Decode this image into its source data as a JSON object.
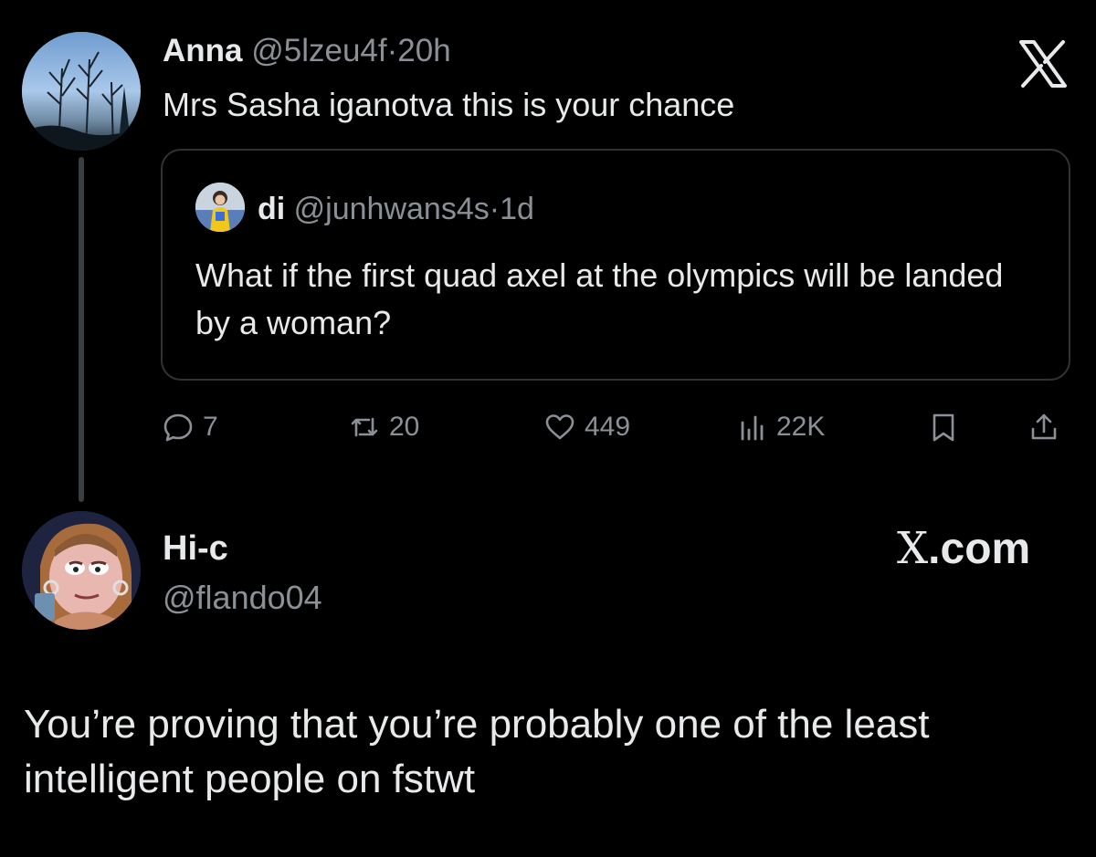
{
  "tweet": {
    "author_name": "Anna",
    "author_handle": "@5lzeu4f",
    "separator": "·",
    "time": "20h",
    "text": "Mrs Sasha iganotva this is your chance",
    "avatar_icon": "forest-trees-sky-avatar"
  },
  "quoted": {
    "author_name": "di",
    "author_handle": "@junhwans4s",
    "separator": "·",
    "time": "1d",
    "text": "What if the first quad axel at the olympics will be landed by a woman?",
    "avatar_icon": "skater-photo-avatar"
  },
  "actions": {
    "reply_count": "7",
    "retweet_count": "20",
    "like_count": "449",
    "view_count": "22K",
    "reply_icon": "reply-icon",
    "retweet_icon": "retweet-icon",
    "like_icon": "heart-icon",
    "views_icon": "views-icon",
    "bookmark_icon": "bookmark-icon",
    "share_icon": "share-icon"
  },
  "reply": {
    "author_name": "Hi-c",
    "author_handle": "@flando04",
    "text": "You’re proving that you’re probably one of the least intelligent people on fstwt",
    "avatar_icon": "cartoon-character-avatar"
  },
  "branding": {
    "watermark_glyph": "X",
    "watermark_suffix": ".com"
  },
  "colors": {
    "background": "#000000",
    "text": "#e7e9ea",
    "muted": "#8b9096",
    "border": "#2f3336"
  }
}
